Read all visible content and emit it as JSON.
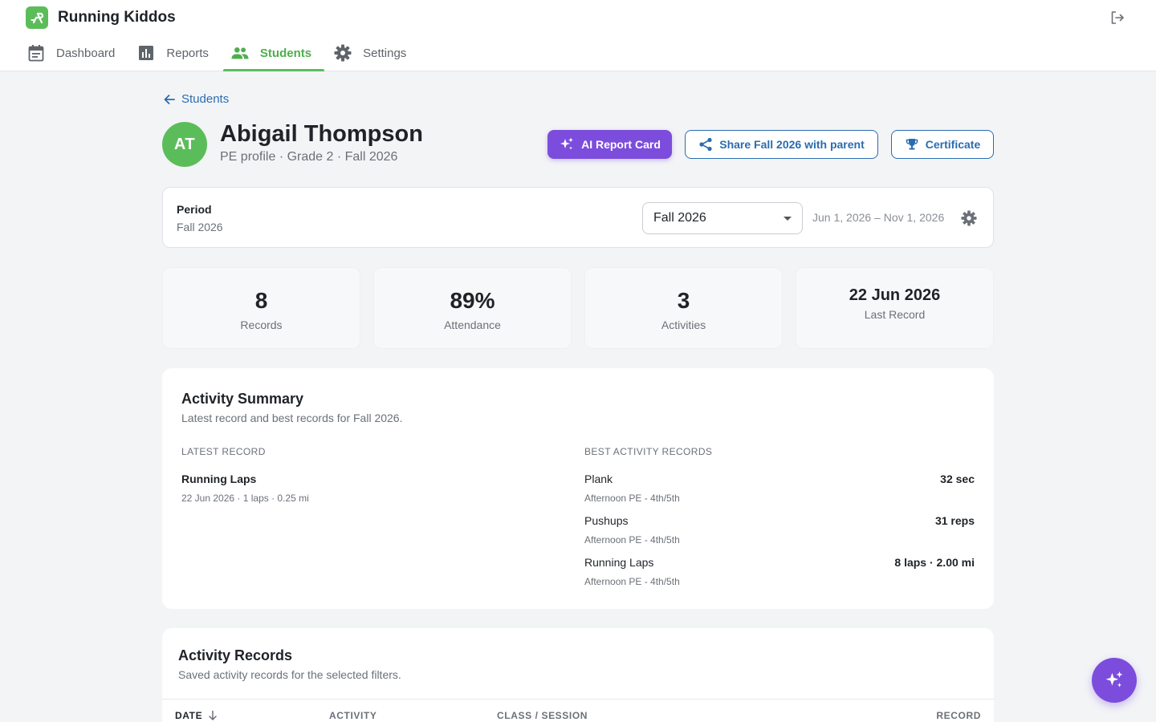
{
  "app": {
    "name": "Running Kiddos",
    "logo_icon": "running-person-icon",
    "brand_color": "#5bbd5a",
    "accent_color": "#7c4ddc",
    "link_color": "#2b6cb0"
  },
  "nav": {
    "items": [
      {
        "label": "Dashboard",
        "icon": "calendar-icon",
        "active": false
      },
      {
        "label": "Reports",
        "icon": "bar-chart-icon",
        "active": false
      },
      {
        "label": "Students",
        "icon": "people-icon",
        "active": true
      },
      {
        "label": "Settings",
        "icon": "gear-icon",
        "active": false
      }
    ]
  },
  "breadcrumb": {
    "back_label": "Students"
  },
  "profile": {
    "initials": "AT",
    "name": "Abigail Thompson",
    "subtitle": "PE profile · Grade 2 · Fall 2026"
  },
  "actions": {
    "ai_report": "AI Report Card",
    "share": "Share Fall 2026 with parent",
    "certificate": "Certificate"
  },
  "period": {
    "label": "Period",
    "value": "Fall 2026",
    "selected": "Fall 2026",
    "range": "Jun 1, 2026 – Nov 1, 2026"
  },
  "stats": [
    {
      "value": "8",
      "label": "Records"
    },
    {
      "value": "89%",
      "label": "Attendance"
    },
    {
      "value": "3",
      "label": "Activities"
    },
    {
      "value": "22 Jun 2026",
      "label": "Last Record"
    }
  ],
  "summary": {
    "title": "Activity Summary",
    "subtitle": "Latest record and best records for Fall 2026.",
    "latest_label": "LATEST RECORD",
    "best_label": "BEST ACTIVITY RECORDS",
    "latest": {
      "name": "Running Laps",
      "meta": "22 Jun 2026 · 1 laps · 0.25 mi"
    },
    "best": [
      {
        "name": "Plank",
        "class": "Afternoon PE - 4th/5th",
        "value": "32 sec"
      },
      {
        "name": "Pushups",
        "class": "Afternoon PE - 4th/5th",
        "value": "31 reps"
      },
      {
        "name": "Running Laps",
        "class": "Afternoon PE - 4th/5th",
        "value": "8 laps · 2.00 mi"
      }
    ]
  },
  "records": {
    "title": "Activity Records",
    "subtitle": "Saved activity records for the selected filters.",
    "columns": [
      "DATE",
      "ACTIVITY",
      "CLASS / SESSION",
      "RECORD"
    ]
  }
}
